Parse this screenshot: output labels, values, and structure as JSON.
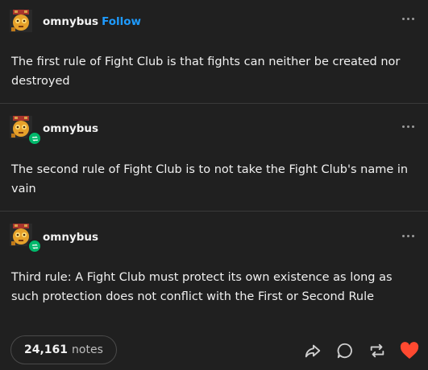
{
  "posts": [
    {
      "username": "omnybus",
      "follow_label": "Follow",
      "text": "The first rule of Fight Club is that fights can neither be created nor destroyed"
    },
    {
      "username": "omnybus",
      "text": "The second rule of Fight Club is to not take the Fight Club's name in vain"
    },
    {
      "username": "omnybus",
      "text": "Third rule: A Fight Club must protect its own existence as long as such protection does not conflict with the First or Second Rule"
    }
  ],
  "footer": {
    "notes_count": "24,161",
    "notes_label": "notes"
  },
  "icons": {
    "share": "share-icon",
    "reply": "reply-icon",
    "reblog": "reblog-icon",
    "like": "heart-icon"
  },
  "colors": {
    "background": "#202020",
    "follow": "#1e9bff",
    "like": "#ff4930",
    "reblog_badge": "#00b86b"
  }
}
